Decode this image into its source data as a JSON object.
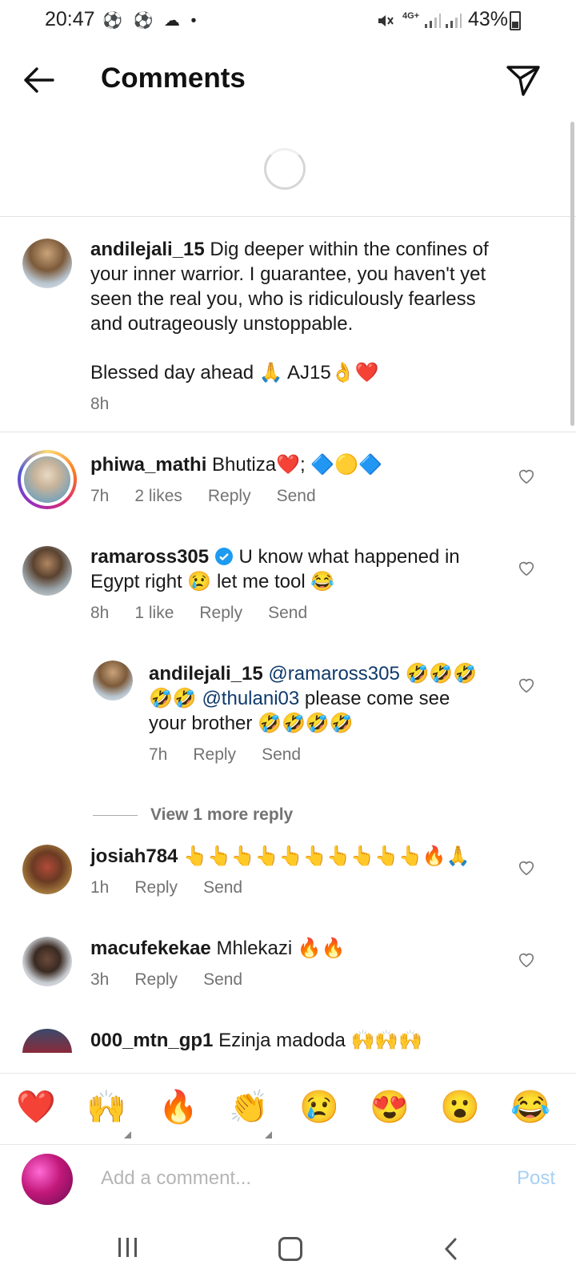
{
  "status_bar": {
    "time": "20:47",
    "left_icons": "⚽ ⚽ ☁ •",
    "network": "4G+",
    "battery_percent": "43%"
  },
  "header": {
    "title": "Comments"
  },
  "caption": {
    "username": "andilejali_15",
    "text_lines": [
      "Dig deeper within the confines of",
      "your inner warrior. I guarantee, you haven't yet",
      "seen the real you, who is ridiculously fearless",
      "and outrageously unstoppable."
    ],
    "blessing": "Blessed  day ahead 🙏 AJ15👌❤️",
    "time": "8h"
  },
  "comments": [
    {
      "username": "phiwa_mathi",
      "text": "Bhutiza❤️; 🔷🟡🔷",
      "time": "7h",
      "likes": "2 likes",
      "reply": "Reply",
      "send": "Send"
    },
    {
      "username": "ramaross305",
      "line1": "U know what happened in",
      "line2": "Egypt right 😢 let me tool 😂",
      "time": "8h",
      "likes": "1 like",
      "reply": "Reply",
      "send": "Send"
    },
    {
      "username": "josiah784",
      "text": "👆👆👆👆👆👆👆👆👆👆🔥🙏",
      "time": "1h",
      "reply": "Reply",
      "send": "Send"
    },
    {
      "username": "macufekekae",
      "text": "Mhlekazi 🔥🔥",
      "time": "3h",
      "reply": "Reply",
      "send": "Send"
    },
    {
      "username": "000_mtn_gp1",
      "text": "Ezinja madoda 🙌🙌🙌"
    }
  ],
  "reply": {
    "username": "andilejali_15",
    "mention1": "@ramaross305",
    "line1_emoji": "🤣🤣🤣",
    "line2_emoji": "🤣🤣",
    "mention2": "@thulani03",
    "line2_text": " please come see",
    "line3": "your brother 🤣🤣🤣🤣",
    "time": "7h",
    "reply": "Reply",
    "send": "Send"
  },
  "view_more": "View 1 more reply",
  "emoji_bar": [
    "❤️",
    "🙌",
    "🔥",
    "👏",
    "😢",
    "😍",
    "😮",
    "😂"
  ],
  "composer": {
    "placeholder": "Add a comment...",
    "post": "Post"
  },
  "colors": {
    "link_blue": "#0f3a6b",
    "verified_blue": "#1d9bf0",
    "post_disabled": "#a7d0f5",
    "meta_gray": "#737373"
  }
}
